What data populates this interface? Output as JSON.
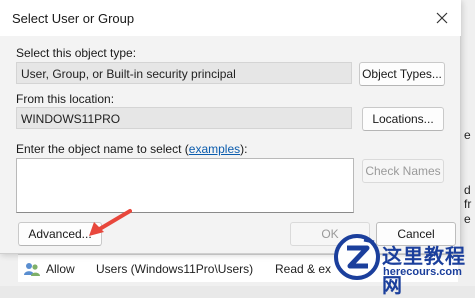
{
  "dialog": {
    "title": "Select User or Group",
    "object_type_label": "Select this object type:",
    "object_type_value": "User, Group, or Built-in security principal",
    "object_types_button": "Object Types...",
    "location_label": "From this location:",
    "location_value": "WINDOWS11PRO",
    "locations_button": "Locations...",
    "enter_name_label_prefix": "Enter the object name to select (",
    "enter_name_link": "examples",
    "enter_name_label_suffix": "):",
    "check_names_button": "Check Names",
    "advanced_button": "Advanced...",
    "ok_button": "OK",
    "cancel_button": "Cancel"
  },
  "background": {
    "right_fragments": [
      "e",
      "d fr",
      "e"
    ],
    "row": {
      "type": "Allow",
      "principal": "Users (Windows11Pro\\Users)",
      "access": "Read & ex"
    }
  },
  "watermark": {
    "title": "这里教程网",
    "url": "herecours.com"
  },
  "colors": {
    "link": "#0b5cad",
    "arrow": "#e8473c",
    "watermark": "#1b3f9c"
  }
}
